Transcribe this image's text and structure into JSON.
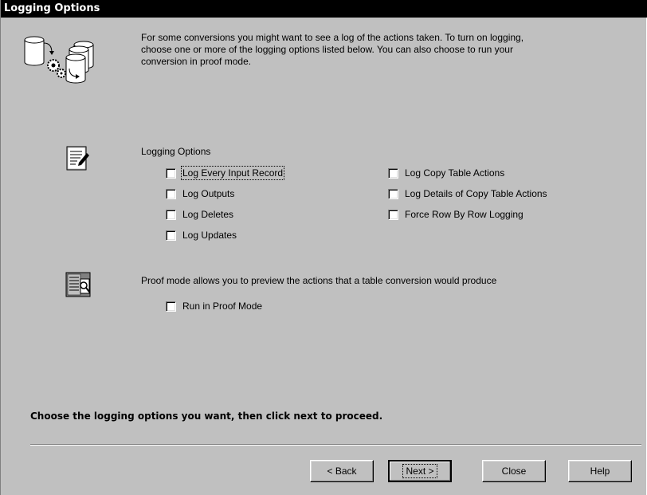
{
  "window": {
    "title": "Logging Options"
  },
  "intro": {
    "line1": "For some conversions you might want to see a log of the actions taken.  To turn on logging,",
    "line2": "choose one or more of the logging options listed below.  You can also choose to run your",
    "line3": "conversion in proof mode."
  },
  "icons": {
    "wizard": "database-conversion-icon",
    "logging": "document-pen-icon",
    "proof": "document-magnifier-icon"
  },
  "logging": {
    "heading": "Logging Options",
    "left": [
      {
        "label": "Log Every Input Record",
        "checked": false
      },
      {
        "label": "Log Outputs",
        "checked": false
      },
      {
        "label": "Log Deletes",
        "checked": false
      },
      {
        "label": "Log Updates",
        "checked": false
      }
    ],
    "right": [
      {
        "label": "Log Copy Table Actions",
        "checked": false
      },
      {
        "label": "Log Details of Copy Table Actions",
        "checked": false
      },
      {
        "label": "Force Row By Row Logging",
        "checked": false
      }
    ]
  },
  "proof": {
    "description": "Proof mode allows you to preview the actions that a table conversion would produce",
    "checkbox": {
      "label": "Run in Proof Mode",
      "checked": false
    }
  },
  "footer": {
    "instruction": "Choose the logging options you want, then click next to proceed."
  },
  "buttons": {
    "back": "< Back",
    "next": "Next >",
    "close": "Close",
    "help": "Help"
  }
}
